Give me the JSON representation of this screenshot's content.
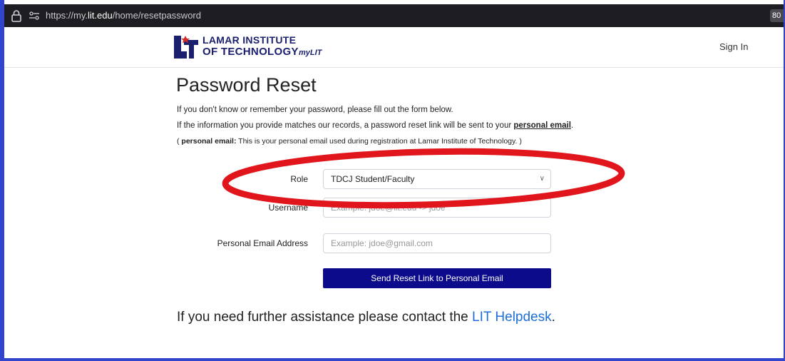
{
  "browser": {
    "url_prefix": "https://my.",
    "url_host": "lit.edu",
    "url_path": "/home/resetpassword",
    "zoom": "80"
  },
  "header": {
    "logo_line1": "LAMAR INSTITUTE",
    "logo_line2": "OF TECHNOLOGY",
    "logo_mylit": "myLIT",
    "sign_in": "Sign In"
  },
  "page": {
    "title": "Password Reset",
    "intro1": "If you don't know or remember your password, please fill out the form below.",
    "intro2_prefix": "If the information you provide matches our records, a password reset link will be sent to your ",
    "intro2_link": "personal email",
    "intro2_suffix": ".",
    "intro3_open": "( ",
    "intro3_bold": "personal email:",
    "intro3_text": " This is your personal email used during registration at Lamar Institute of Technology. )"
  },
  "form": {
    "role_label": "Role",
    "role_value": "TDCJ Student/Faculty",
    "username_label": "Username",
    "username_placeholder": "Example: jdoe@lit.edu -> jdoe",
    "email_label": "Personal Email Address",
    "email_placeholder": "Example: jdoe@gmail.com",
    "submit_label": "Send Reset Link to Personal Email"
  },
  "help": {
    "prefix": "If you need further assistance please contact the ",
    "link": "LIT Helpdesk",
    "suffix": "."
  },
  "colors": {
    "brand_navy": "#1a1f6e",
    "button": "#0b0b8c",
    "link": "#1d6fd8",
    "annotation": "#e0161c"
  }
}
